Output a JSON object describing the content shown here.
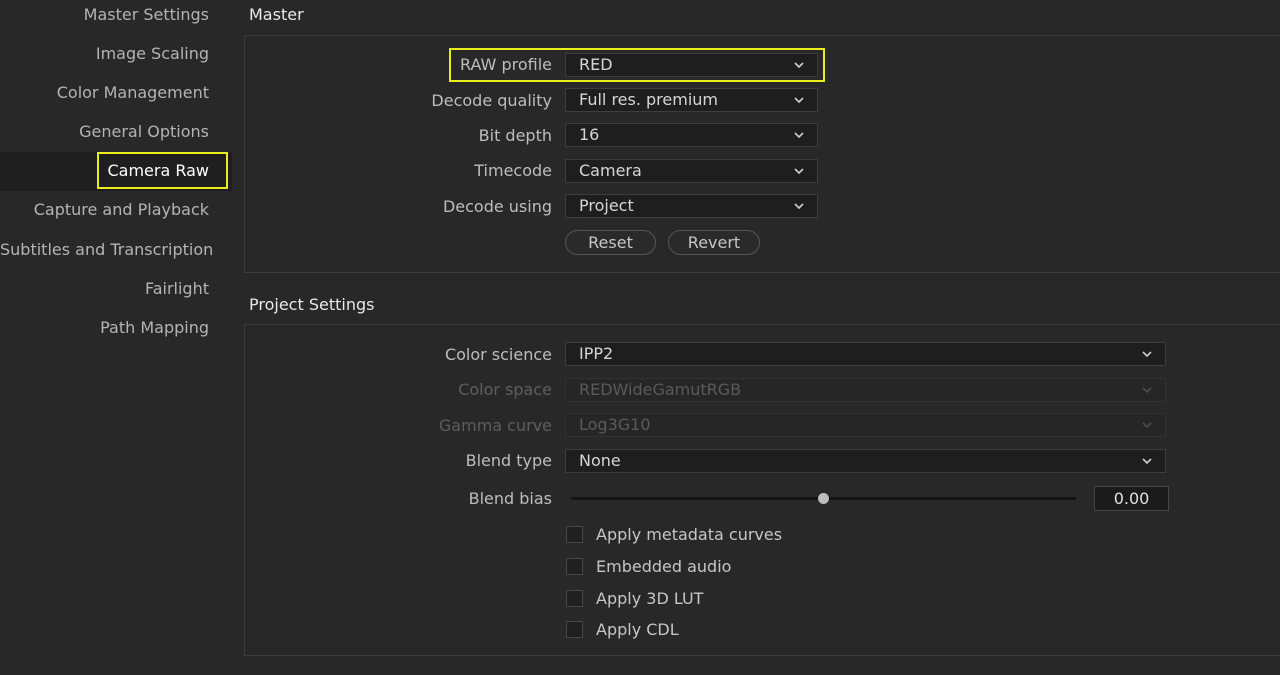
{
  "sidebar": {
    "items": [
      {
        "label": "Master Settings"
      },
      {
        "label": "Image Scaling"
      },
      {
        "label": "Color Management"
      },
      {
        "label": "General Options"
      },
      {
        "label": "Camera Raw",
        "active": true
      },
      {
        "label": "Capture and Playback"
      },
      {
        "label": "Subtitles and Transcription"
      },
      {
        "label": "Fairlight"
      },
      {
        "label": "Path Mapping"
      }
    ]
  },
  "master": {
    "title": "Master",
    "raw_profile": {
      "label": "RAW profile",
      "value": "RED"
    },
    "decode_quality": {
      "label": "Decode quality",
      "value": "Full res. premium"
    },
    "bit_depth": {
      "label": "Bit depth",
      "value": "16"
    },
    "timecode": {
      "label": "Timecode",
      "value": "Camera"
    },
    "decode_using": {
      "label": "Decode using",
      "value": "Project"
    },
    "reset_label": "Reset",
    "revert_label": "Revert"
  },
  "project": {
    "title": "Project Settings",
    "color_science": {
      "label": "Color science",
      "value": "IPP2"
    },
    "color_space": {
      "label": "Color space",
      "value": "REDWideGamutRGB",
      "disabled": true
    },
    "gamma_curve": {
      "label": "Gamma curve",
      "value": "Log3G10",
      "disabled": true
    },
    "blend_type": {
      "label": "Blend type",
      "value": "None"
    },
    "blend_bias": {
      "label": "Blend bias",
      "value": "0.00",
      "slider_fraction": 0.5
    },
    "checkboxes": [
      {
        "label": "Apply metadata curves",
        "checked": false
      },
      {
        "label": "Embedded audio",
        "checked": false
      },
      {
        "label": "Apply 3D LUT",
        "checked": false
      },
      {
        "label": "Apply CDL",
        "checked": false
      }
    ]
  },
  "colors": {
    "highlight": "#ecec1c",
    "background": "#282828"
  }
}
